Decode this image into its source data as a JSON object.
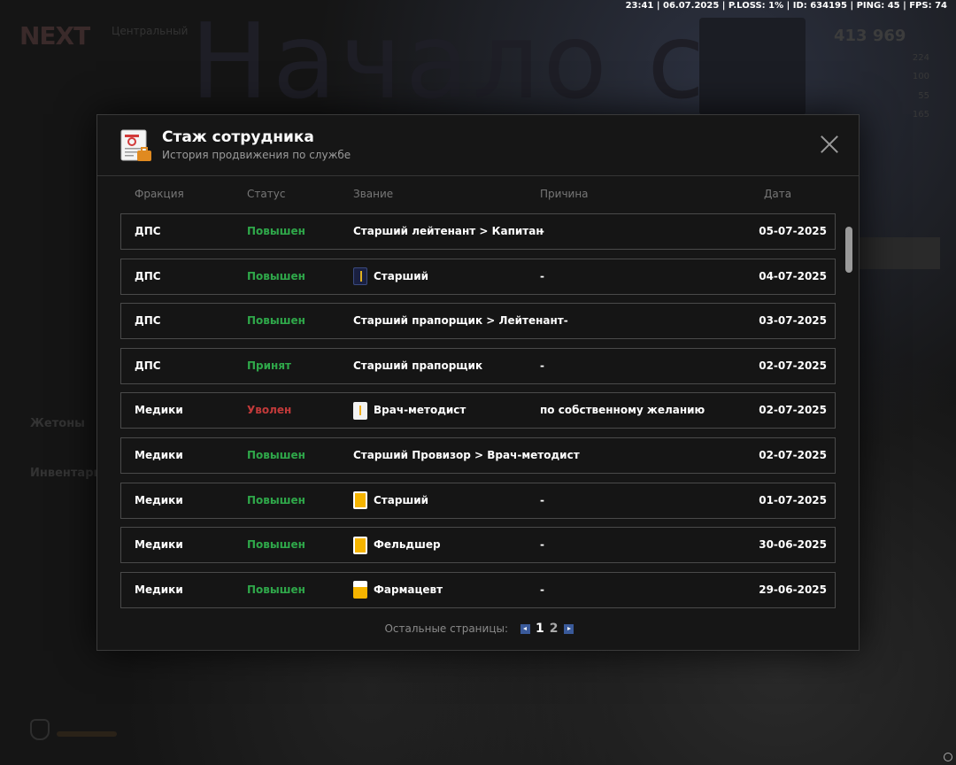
{
  "hud": {
    "text": "23:41 | 06.07.2025 | P.LOSS: 1% | ID: 634195 | PING: 45 | FPS: 74"
  },
  "background": {
    "big_title": "Начало с",
    "logo": "NEXT",
    "central": "Центральный",
    "money": "413 969",
    "stat_1": "224",
    "stat_2": "100",
    "stat_3": "55",
    "stat_4": "165",
    "tokens_label": "Жетоны",
    "inventory_label": "Инвентарь"
  },
  "modal": {
    "title": "Стаж сотрудника",
    "subtitle": "История продвижения по службе",
    "columns": {
      "faction": "Фракция",
      "status": "Статус",
      "rank": "Звание",
      "reason": "Причина",
      "date": "Дата"
    },
    "rows": [
      {
        "faction": "ДПС",
        "status": "Повышен",
        "status_type": "ok",
        "rank": "Старший лейтенант > Капитан",
        "rank_icon": "",
        "reason": "-",
        "date": "05-07-2025"
      },
      {
        "faction": "ДПС",
        "status": "Повышен",
        "status_type": "ok",
        "rank": "Старший",
        "rank_icon": "navy-epaulette-icon",
        "reason": "-",
        "date": "04-07-2025"
      },
      {
        "faction": "ДПС",
        "status": "Повышен",
        "status_type": "ok",
        "rank": "Старший прапорщик > Лейтенант-",
        "rank_icon": "",
        "reason": "",
        "date": "03-07-2025"
      },
      {
        "faction": "ДПС",
        "status": "Принят",
        "status_type": "ok",
        "rank": "Старший прапорщик",
        "rank_icon": "",
        "reason": "-",
        "date": "02-07-2025"
      },
      {
        "faction": "Медики",
        "status": "Уволен",
        "status_type": "bad",
        "rank": "Врач-методист",
        "rank_icon": "white-epaulette-icon",
        "reason": "по собственному желанию",
        "date": "02-07-2025"
      },
      {
        "faction": "Медики",
        "status": "Повышен",
        "status_type": "ok",
        "rank": "Старший Провизор > Врач-методист",
        "rank_icon": "",
        "reason": "",
        "date": "02-07-2025"
      },
      {
        "faction": "Медики",
        "status": "Повышен",
        "status_type": "ok",
        "rank": "Старший",
        "rank_icon": "yellow-epaulette-icon",
        "reason": "-",
        "date": "01-07-2025"
      },
      {
        "faction": "Медики",
        "status": "Повышен",
        "status_type": "ok",
        "rank": "Фельдшер",
        "rank_icon": "yellow-epaulette-icon",
        "reason": "-",
        "date": "30-06-2025"
      },
      {
        "faction": "Медики",
        "status": "Повышен",
        "status_type": "ok",
        "rank": "Фармацевт",
        "rank_icon": "yellow-white-epaulette-icon",
        "reason": "-",
        "date": "29-06-2025"
      }
    ],
    "pager": {
      "label": "Остальные страницы:",
      "pages": [
        "1",
        "2"
      ],
      "current": "1"
    }
  },
  "colors": {
    "status_ok": "#2fa84a",
    "status_bad": "#c23a3a",
    "pager_arrow": "#3a5a9a"
  }
}
